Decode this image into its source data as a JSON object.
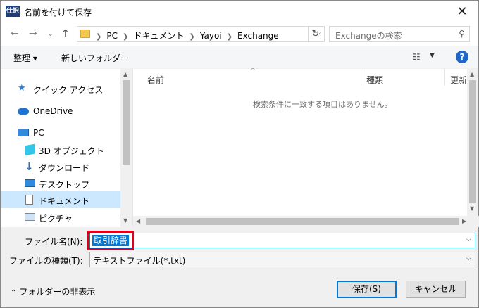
{
  "window": {
    "title": "名前を付けて保存",
    "app_icon_text": "仕訳"
  },
  "nav": {
    "back": "←",
    "forward": "→",
    "recent": "⌄",
    "up": "↑",
    "path": [
      "PC",
      "ドキュメント",
      "Yayoi",
      "Exchange"
    ],
    "search_placeholder": "Exchangeの検索"
  },
  "toolbar": {
    "organize": "整理 ▾",
    "new_folder": "新しいフォルダー"
  },
  "sidebar": {
    "items": [
      {
        "label": "クイック アクセス",
        "icon": "star-icon"
      },
      {
        "label": "OneDrive",
        "icon": "cloud-icon"
      },
      {
        "label": "PC",
        "icon": "pc-icon"
      },
      {
        "label": "3D オブジェクト",
        "icon": "cube-icon"
      },
      {
        "label": "ダウンロード",
        "icon": "download-icon"
      },
      {
        "label": "デスクトップ",
        "icon": "desktop-icon"
      },
      {
        "label": "ドキュメント",
        "icon": "document-icon",
        "selected": true
      },
      {
        "label": "ピクチャ",
        "icon": "picture-icon"
      }
    ]
  },
  "filelist": {
    "columns": [
      "名前",
      "種類",
      "更新"
    ],
    "empty_message": "検索条件に一致する項目はありません。"
  },
  "form": {
    "filename_label": "ファイル名(N):",
    "filename_value": "取引辞書",
    "filetype_label": "ファイルの種類(T):",
    "filetype_value": "テキストファイル(*.txt)"
  },
  "footer": {
    "hide_folders": "フォルダーの非表示",
    "save": "保存(S)",
    "cancel": "キャンセル"
  },
  "colors": {
    "accent": "#0078d7",
    "selection": "#cce8ff",
    "highlight_border": "#e0001b"
  }
}
